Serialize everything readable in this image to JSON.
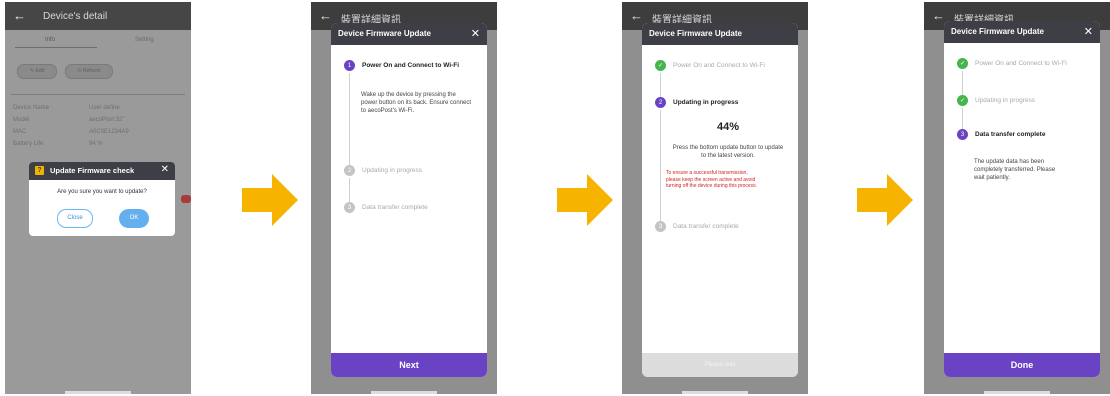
{
  "screen1": {
    "title": "Device's detail",
    "tabs": [
      "Info",
      "Setting"
    ],
    "edit_label": "Edit",
    "refresh_label": "Refresh",
    "rows": [
      {
        "label": "Device Name",
        "value": "User define"
      },
      {
        "label": "Model",
        "value": "aecoPost 32\""
      },
      {
        "label": "MAC",
        "value": "A0C0E1234A9"
      },
      {
        "label": "Battery Life",
        "value": "94 %"
      }
    ],
    "dialog": {
      "title": "Update Firmware check",
      "message": "Are you sure you want to update?",
      "close_label": "Close",
      "ok_label": "OK"
    }
  },
  "screen_bg_title": "裝置詳細資訊",
  "modal": {
    "title": "Device Firmware Update",
    "steps": [
      "Power On and Connect to Wi-Fi",
      "Updating in progress",
      "Data transfer complete"
    ]
  },
  "screen2": {
    "desc": "Wake up the device by pressing the power button on its back. Ensure connect to aecoPost's Wi-Fi.",
    "button": "Next"
  },
  "screen3": {
    "percent": "44%",
    "desc": "Press the bottom update button to update to the latest version.",
    "warning": "To ensure a successful transmission, please keep the screen active and avoid turning off the device during this process.",
    "button": "Please wait"
  },
  "screen4": {
    "desc": "The update data has been completely transferred. Please wait patiently.",
    "button": "Done"
  }
}
